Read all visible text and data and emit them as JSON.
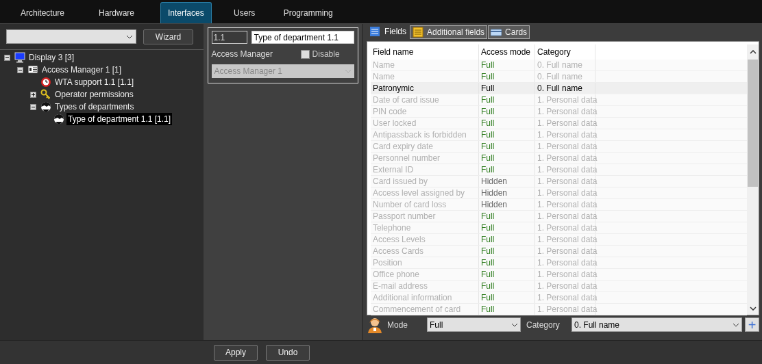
{
  "top_tabs": [
    {
      "label": "Architecture",
      "selected": false
    },
    {
      "label": "Hardware",
      "selected": false
    },
    {
      "label": "Interfaces",
      "selected": true
    },
    {
      "label": "Users",
      "selected": false
    },
    {
      "label": "Programming",
      "selected": false
    }
  ],
  "left": {
    "wizard_button": "Wizard",
    "tree": [
      {
        "label": "Display 3 [3]",
        "kind": "monitor",
        "expanded": true,
        "selected": false,
        "children": [
          {
            "label": "Access Manager 1 [1]",
            "kind": "card",
            "expanded": true,
            "selected": false,
            "children": [
              {
                "label": "WTA support 1.1 [1.1]",
                "kind": "clock",
                "selected": false
              },
              {
                "label": "Operator permissions",
                "kind": "key",
                "expanded": false,
                "selected": false
              },
              {
                "label": "Types of departments",
                "kind": "mask",
                "expanded": true,
                "selected": false,
                "children": [
                  {
                    "label": "Type of department 1.1 [1.1]",
                    "kind": "mask",
                    "selected": true
                  }
                ]
              }
            ]
          }
        ]
      }
    ]
  },
  "properties": {
    "number": "1.1",
    "name": "Type of department 1.1",
    "manager_label": "Access Manager",
    "disable": {
      "label": "Disable",
      "checked": false
    },
    "manager_value": "Access Manager 1"
  },
  "field_tabs": [
    {
      "label": "Fields",
      "kind": "list",
      "selected": true
    },
    {
      "label": "Additional fields",
      "kind": "note",
      "selected": false
    },
    {
      "label": "Cards",
      "kind": "card",
      "selected": false
    }
  ],
  "table": {
    "columns": [
      "Field name",
      "Access mode",
      "Category"
    ],
    "rows": [
      {
        "field": "Name",
        "access": "Full",
        "kind": "full",
        "category": "0. Full name",
        "selected": false
      },
      {
        "field": "Name",
        "access": "Full",
        "kind": "full",
        "category": "0. Full name",
        "selected": false
      },
      {
        "field": "Patronymic",
        "access": "Full",
        "kind": "full",
        "category": "0. Full name",
        "selected": true
      },
      {
        "field": "Date of card issue",
        "access": "Full",
        "kind": "full",
        "category": "1. Personal data",
        "selected": false
      },
      {
        "field": "PIN code",
        "access": "Full",
        "kind": "full",
        "category": "1. Personal data",
        "selected": false
      },
      {
        "field": "User locked",
        "access": "Full",
        "kind": "full",
        "category": "1. Personal data",
        "selected": false
      },
      {
        "field": "Antipassback is forbidden",
        "access": "Full",
        "kind": "full",
        "category": "1. Personal data",
        "selected": false
      },
      {
        "field": "Card expiry date",
        "access": "Full",
        "kind": "full",
        "category": "1. Personal data",
        "selected": false
      },
      {
        "field": "Personnel number",
        "access": "Full",
        "kind": "full",
        "category": "1. Personal data",
        "selected": false
      },
      {
        "field": "External ID",
        "access": "Full",
        "kind": "full",
        "category": "1. Personal data",
        "selected": false
      },
      {
        "field": "Card issued by",
        "access": "Hidden",
        "kind": "hidden",
        "category": "1. Personal data",
        "selected": false
      },
      {
        "field": "Access level assigned by",
        "access": "Hidden",
        "kind": "hidden",
        "category": "1. Personal data",
        "selected": false
      },
      {
        "field": "Number of card loss",
        "access": "Hidden",
        "kind": "hidden",
        "category": "1. Personal data",
        "selected": false
      },
      {
        "field": "Passport number",
        "access": "Full",
        "kind": "full",
        "category": "1. Personal data",
        "selected": false
      },
      {
        "field": "Telephone",
        "access": "Full",
        "kind": "full",
        "category": "1. Personal data",
        "selected": false
      },
      {
        "field": "Access Levels",
        "access": "Full",
        "kind": "full",
        "category": "1. Personal data",
        "selected": false
      },
      {
        "field": "Access Cards",
        "access": "Full",
        "kind": "full",
        "category": "1. Personal data",
        "selected": false
      },
      {
        "field": "Position",
        "access": "Full",
        "kind": "full",
        "category": "1. Personal data",
        "selected": false
      },
      {
        "field": "Office phone",
        "access": "Full",
        "kind": "full",
        "category": "1. Personal data",
        "selected": false
      },
      {
        "field": "E-mail address",
        "access": "Full",
        "kind": "full",
        "category": "1. Personal data",
        "selected": false
      },
      {
        "field": "Additional information",
        "access": "Full",
        "kind": "full",
        "category": "1. Personal data",
        "selected": false
      },
      {
        "field": "Commencement of card",
        "access": "Full",
        "kind": "full",
        "category": "1. Personal data",
        "selected": false
      }
    ]
  },
  "mode_bar": {
    "mode_label": "Mode",
    "mode_value": "Full",
    "category_label": "Category",
    "category_value": "0. Full name",
    "add_button": "+"
  },
  "bottom_buttons": [
    "Apply",
    "Undo"
  ]
}
